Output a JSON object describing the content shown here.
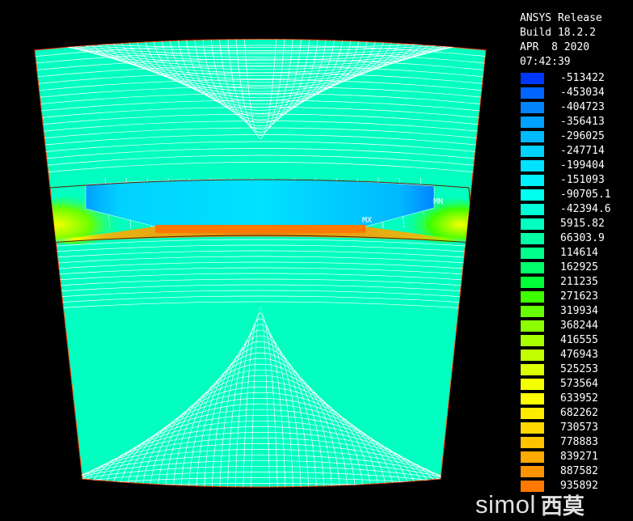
{
  "header": {
    "line1": "ANSYS Release",
    "line2": "Build 18.2.2",
    "line3": "APR  8 2020",
    "line4": "07:42:39"
  },
  "legend": [
    {
      "value": "-513422",
      "color": "#0037ff"
    },
    {
      "value": "-453034",
      "color": "#0066ff"
    },
    {
      "value": "-404723",
      "color": "#0085ff"
    },
    {
      "value": "-356413",
      "color": "#00a1ff"
    },
    {
      "value": "-296025",
      "color": "#00b9ff"
    },
    {
      "value": "-247714",
      "color": "#00d2ff"
    },
    {
      "value": "-199404",
      "color": "#00e2ff"
    },
    {
      "value": "-151093",
      "color": "#00f0ff"
    },
    {
      "value": "-90705.1",
      "color": "#00ffee"
    },
    {
      "value": "-42394.6",
      "color": "#00ffd8"
    },
    {
      "value": "5915.82",
      "color": "#00ffc0"
    },
    {
      "value": "66303.9",
      "color": "#00ffa6"
    },
    {
      "value": "114614",
      "color": "#00ff8b"
    },
    {
      "value": "162925",
      "color": "#00ff6a"
    },
    {
      "value": "211235",
      "color": "#00ff37"
    },
    {
      "value": "271623",
      "color": "#3dff00"
    },
    {
      "value": "319934",
      "color": "#66ff00"
    },
    {
      "value": "368244",
      "color": "#8bff00"
    },
    {
      "value": "416555",
      "color": "#a8ff00"
    },
    {
      "value": "476943",
      "color": "#c2ff00"
    },
    {
      "value": "525253",
      "color": "#dbff00"
    },
    {
      "value": "573564",
      "color": "#f4ff00"
    },
    {
      "value": "633952",
      "color": "#ffff00"
    },
    {
      "value": "682262",
      "color": "#ffeb00"
    },
    {
      "value": "730573",
      "color": "#ffd800"
    },
    {
      "value": "778883",
      "color": "#ffc200"
    },
    {
      "value": "839271",
      "color": "#ffaa00"
    },
    {
      "value": "887582",
      "color": "#ff9400"
    },
    {
      "value": "935892",
      "color": "#ff7800"
    }
  ],
  "plot": {
    "background_color": "#00ffc0",
    "min_label": "MN",
    "max_label": "MX",
    "contour_line_color": "#ffffff"
  },
  "watermark": {
    "latin": "simol",
    "cjk": "西莫"
  }
}
